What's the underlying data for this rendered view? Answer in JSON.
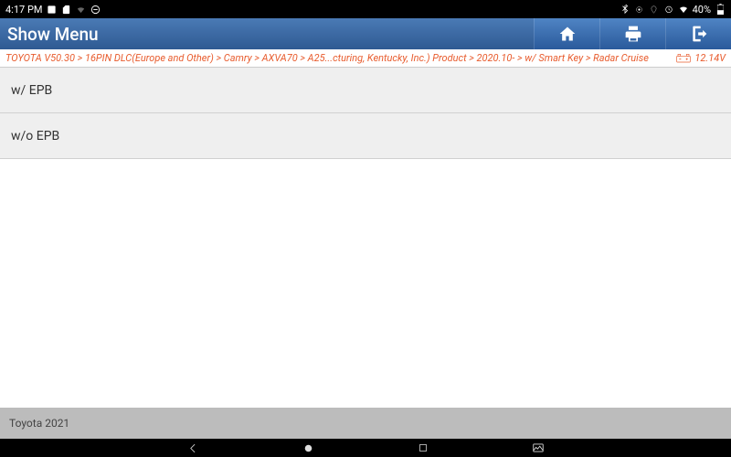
{
  "status": {
    "time": "4:17 PM",
    "battery_pct": "40%"
  },
  "title": "Show Menu",
  "breadcrumb": "TOYOTA V50.30 > 16PIN DLC(Europe and Other) > Camry > AXVA70 > A25...cturing, Kentucky, Inc.) Product > 2020.10- > w/ Smart Key > Radar Cruise",
  "voltage": "12.14V",
  "menu_items": [
    {
      "label": "w/ EPB"
    },
    {
      "label": "w/o EPB"
    }
  ],
  "footer": "Toyota  2021"
}
